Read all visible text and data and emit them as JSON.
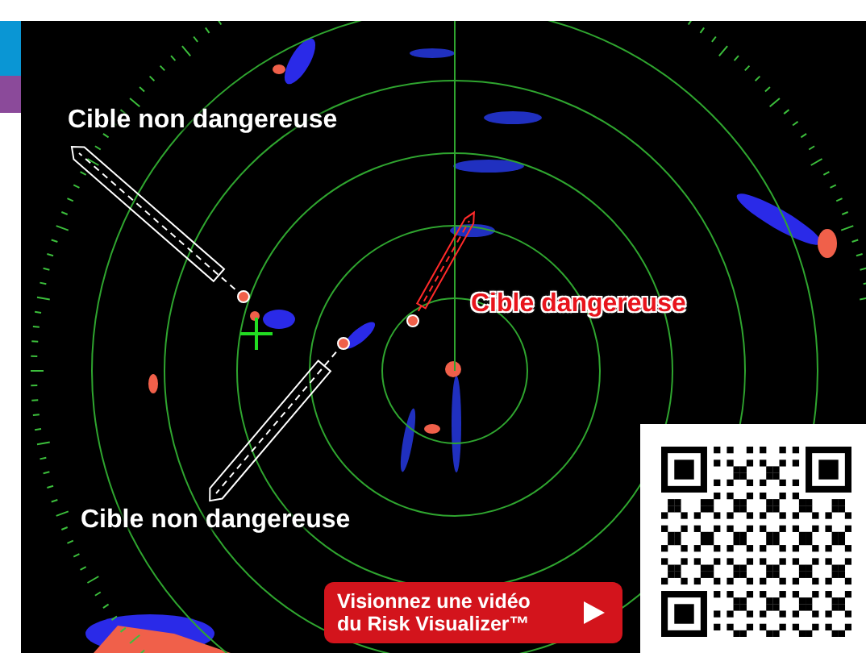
{
  "radar": {
    "targets": [
      {
        "kind": "safe",
        "label": "Cible non dangereuse"
      },
      {
        "kind": "danger",
        "label": "Cible dangereuse"
      },
      {
        "kind": "safe",
        "label": "Cible non dangereuse"
      }
    ]
  },
  "video_button": {
    "lines": [
      "Visionnez une vidéo",
      "du Risk Visualizer™"
    ]
  }
}
